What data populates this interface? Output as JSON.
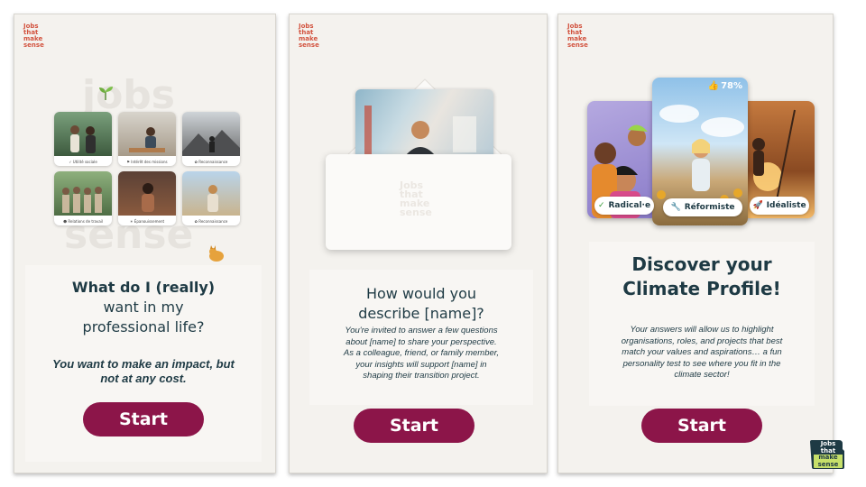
{
  "brand": {
    "logo_lines": [
      "Jobs",
      "that",
      "make",
      "sense"
    ]
  },
  "screen1": {
    "tiles": [
      {
        "caption": "✓ Utilité sociale",
        "icon": "check-icon"
      },
      {
        "caption": "⚑ Intérêt des missions",
        "icon": "flag-icon"
      },
      {
        "caption": "✿ Reconnaissance",
        "icon": "flower-icon"
      },
      {
        "caption": "☻ Relations de travail",
        "icon": "people-icon"
      },
      {
        "caption": "☀ Épanouissement",
        "icon": "sun-icon"
      },
      {
        "caption": "✿ Reconnaissance",
        "icon": "flower-icon"
      }
    ],
    "title_line1": "What do I (really)",
    "title_line2": "want in my",
    "title_line3": "professional life?",
    "subtitle": "You want to make an impact, but not at any cost.",
    "start_label": "Start"
  },
  "screen2": {
    "title_line1": "How would you",
    "title_line2": "describe [name]?",
    "body": "You're invited to answer a few questions about [name] to share your perspective. As a colleague, friend, or family member, your insights will support [name] in shaping their transition project.",
    "start_label": "Start"
  },
  "screen3": {
    "cards": {
      "left_tag": "Radical·e",
      "center_tag": "Réformiste",
      "right_tag": "Idéaliste",
      "center_percent": "78%"
    },
    "title_line1": "Discover your",
    "title_line2": "Climate Profile!",
    "body": "Your answers will allow us to highlight organisations, roles, and projects that best match your values and aspirations… a fun personality test to see where you fit in the climate sector!",
    "start_label": "Start"
  },
  "corner_logo": {
    "lines": [
      "Jobs",
      "that",
      "make",
      "sense"
    ]
  },
  "colors": {
    "accent": "#8c1549",
    "title": "#1e3a44",
    "logo": "#d2533f",
    "corner_logo_bg": "#c6e06a"
  }
}
